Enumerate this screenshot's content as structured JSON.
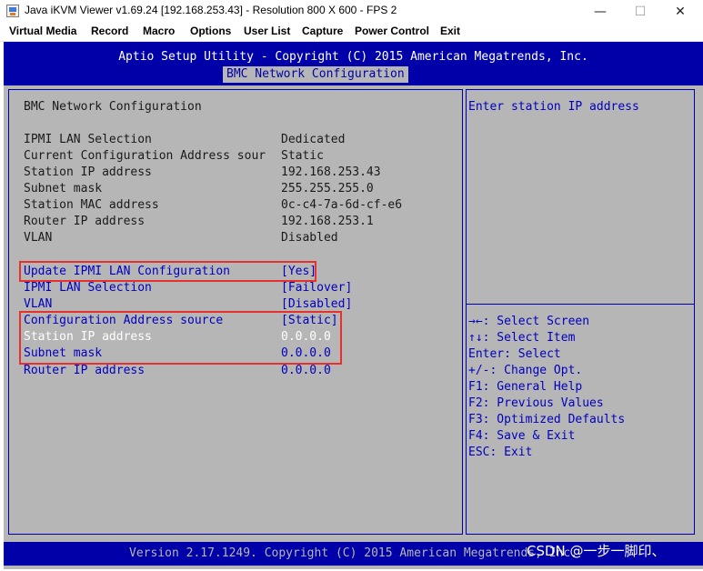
{
  "window": {
    "title": "Java iKVM Viewer v1.69.24 [192.168.253.43]  - Resolution 800 X 600 - FPS 2",
    "minimize": "—",
    "maximize": "☐",
    "close": "✕",
    "icon": "java-cup-icon"
  },
  "menu": [
    "Virtual Media",
    "Record",
    "Macro",
    "Options",
    "User List",
    "Capture",
    "Power Control",
    "Exit"
  ],
  "bios": {
    "header_title": "Aptio Setup Utility - Copyright (C) 2015 American Megatrends, Inc.",
    "active_tab": "BMC Network Configuration",
    "section_title": "BMC Network Configuration",
    "info_rows": [
      {
        "label": "IPMI LAN Selection",
        "value": "Dedicated"
      },
      {
        "label": "Current Configuration Address sour",
        "value": "Static"
      },
      {
        "label": "Station IP address",
        "value": "192.168.253.43"
      },
      {
        "label": "Subnet mask",
        "value": "255.255.255.0"
      },
      {
        "label": "Station MAC address",
        "value": "0c-c4-7a-6d-cf-e6"
      },
      {
        "label": "Router IP address",
        "value": "192.168.253.1"
      },
      {
        "label": "VLAN",
        "value": "Disabled"
      }
    ],
    "settings": [
      {
        "label": "Update IPMI LAN Configuration",
        "value": "[Yes]"
      },
      {
        "label": "IPMI LAN Selection",
        "value": "[Failover]"
      },
      {
        "label": "VLAN",
        "value": "[Disabled]"
      },
      {
        "label": "Configuration Address source",
        "value": "[Static]"
      },
      {
        "label": "Station IP address",
        "value": "0.0.0.0",
        "selected": true
      },
      {
        "label": "Subnet mask",
        "value": "0.0.0.0"
      },
      {
        "label": "Router IP address",
        "value": "0.0.0.0"
      }
    ],
    "help_text": "Enter station IP address",
    "key_help": [
      "→←: Select Screen",
      "↑↓: Select Item",
      "Enter: Select",
      "+/-: Change Opt.",
      "F1: General Help",
      "F2: Previous Values",
      "F3: Optimized Defaults",
      "F4: Save & Exit",
      "ESC: Exit"
    ],
    "footer": "Version 2.17.1249. Copyright (C) 2015 American Megatrends, Inc.",
    "watermark": "CSDN @一步一脚印、"
  },
  "colors": {
    "bios_blue": "#0000a8",
    "bios_gray": "#b6b6b6",
    "highlight_red": "#e8312f"
  }
}
